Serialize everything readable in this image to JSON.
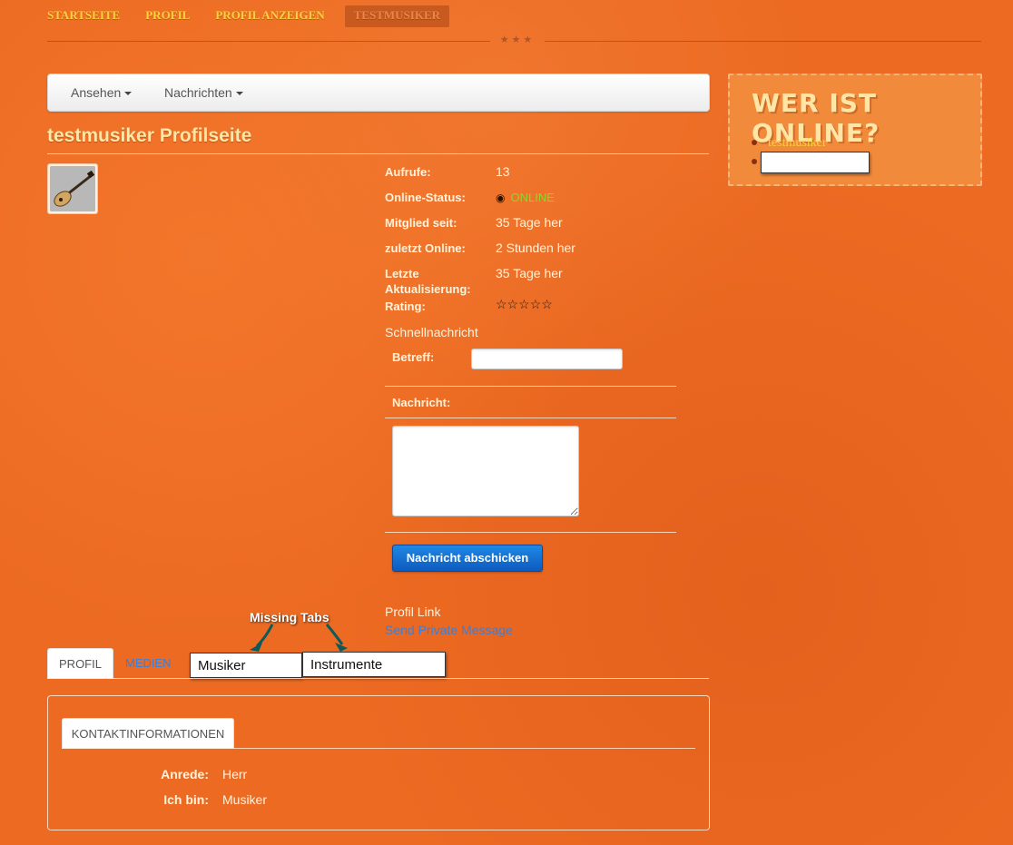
{
  "topnav": {
    "items": [
      {
        "label": "STARTSEITE"
      },
      {
        "label": "PROFIL"
      },
      {
        "label": "PROFIL ANZEIGEN"
      },
      {
        "label": "TESTMUSIKER",
        "active": true
      }
    ]
  },
  "toolbar": {
    "view_label": "Ansehen",
    "messages_label": "Nachrichten"
  },
  "profile": {
    "title": "testmusiker Profilseite",
    "rows": {
      "views_label": "Aufrufe:",
      "views_value": "13",
      "status_label": "Online-Status:",
      "status_value": "ONLINE",
      "member_label": "Mitglied seit:",
      "member_value": "35 Tage her",
      "last_online_label": "zuletzt Online:",
      "last_online_value": "2 Stunden her",
      "updated_label": "Letzte Aktualisierung:",
      "updated_value": "35 Tage her",
      "rating_label": "Rating:",
      "rating_value": "☆☆☆☆☆"
    }
  },
  "quickmessage": {
    "title": "Schnellnachricht",
    "subject_label": "Betreff:",
    "subject_value": "",
    "message_label": "Nachricht:",
    "message_value": "",
    "send_label": "Nachricht abschicken"
  },
  "links": {
    "profile_link": "Profil Link",
    "private_message": "Send Private Message"
  },
  "annotation": {
    "text": "Missing Tabs"
  },
  "tabs": [
    {
      "label": "PROFIL",
      "active": true
    },
    {
      "label": "MEDIEN"
    },
    {
      "label": "Musiker"
    },
    {
      "label": "Instrumente"
    }
  ],
  "contact": {
    "tab_label": "KONTAKTINFORMATIONEN",
    "salutation_label": "Anrede:",
    "salutation_value": "Herr",
    "iam_label": "Ich bin:",
    "iam_value": "Musiker"
  },
  "sidebar": {
    "title": "WER IST ONLINE?",
    "users": [
      "testmusiker"
    ]
  },
  "colors": {
    "background": "#ec6a22",
    "nav_text": "#f9d33c",
    "online_green": "#8fd62b",
    "link_blue": "#3c7fd6",
    "button_blue": "#1e88e5"
  }
}
